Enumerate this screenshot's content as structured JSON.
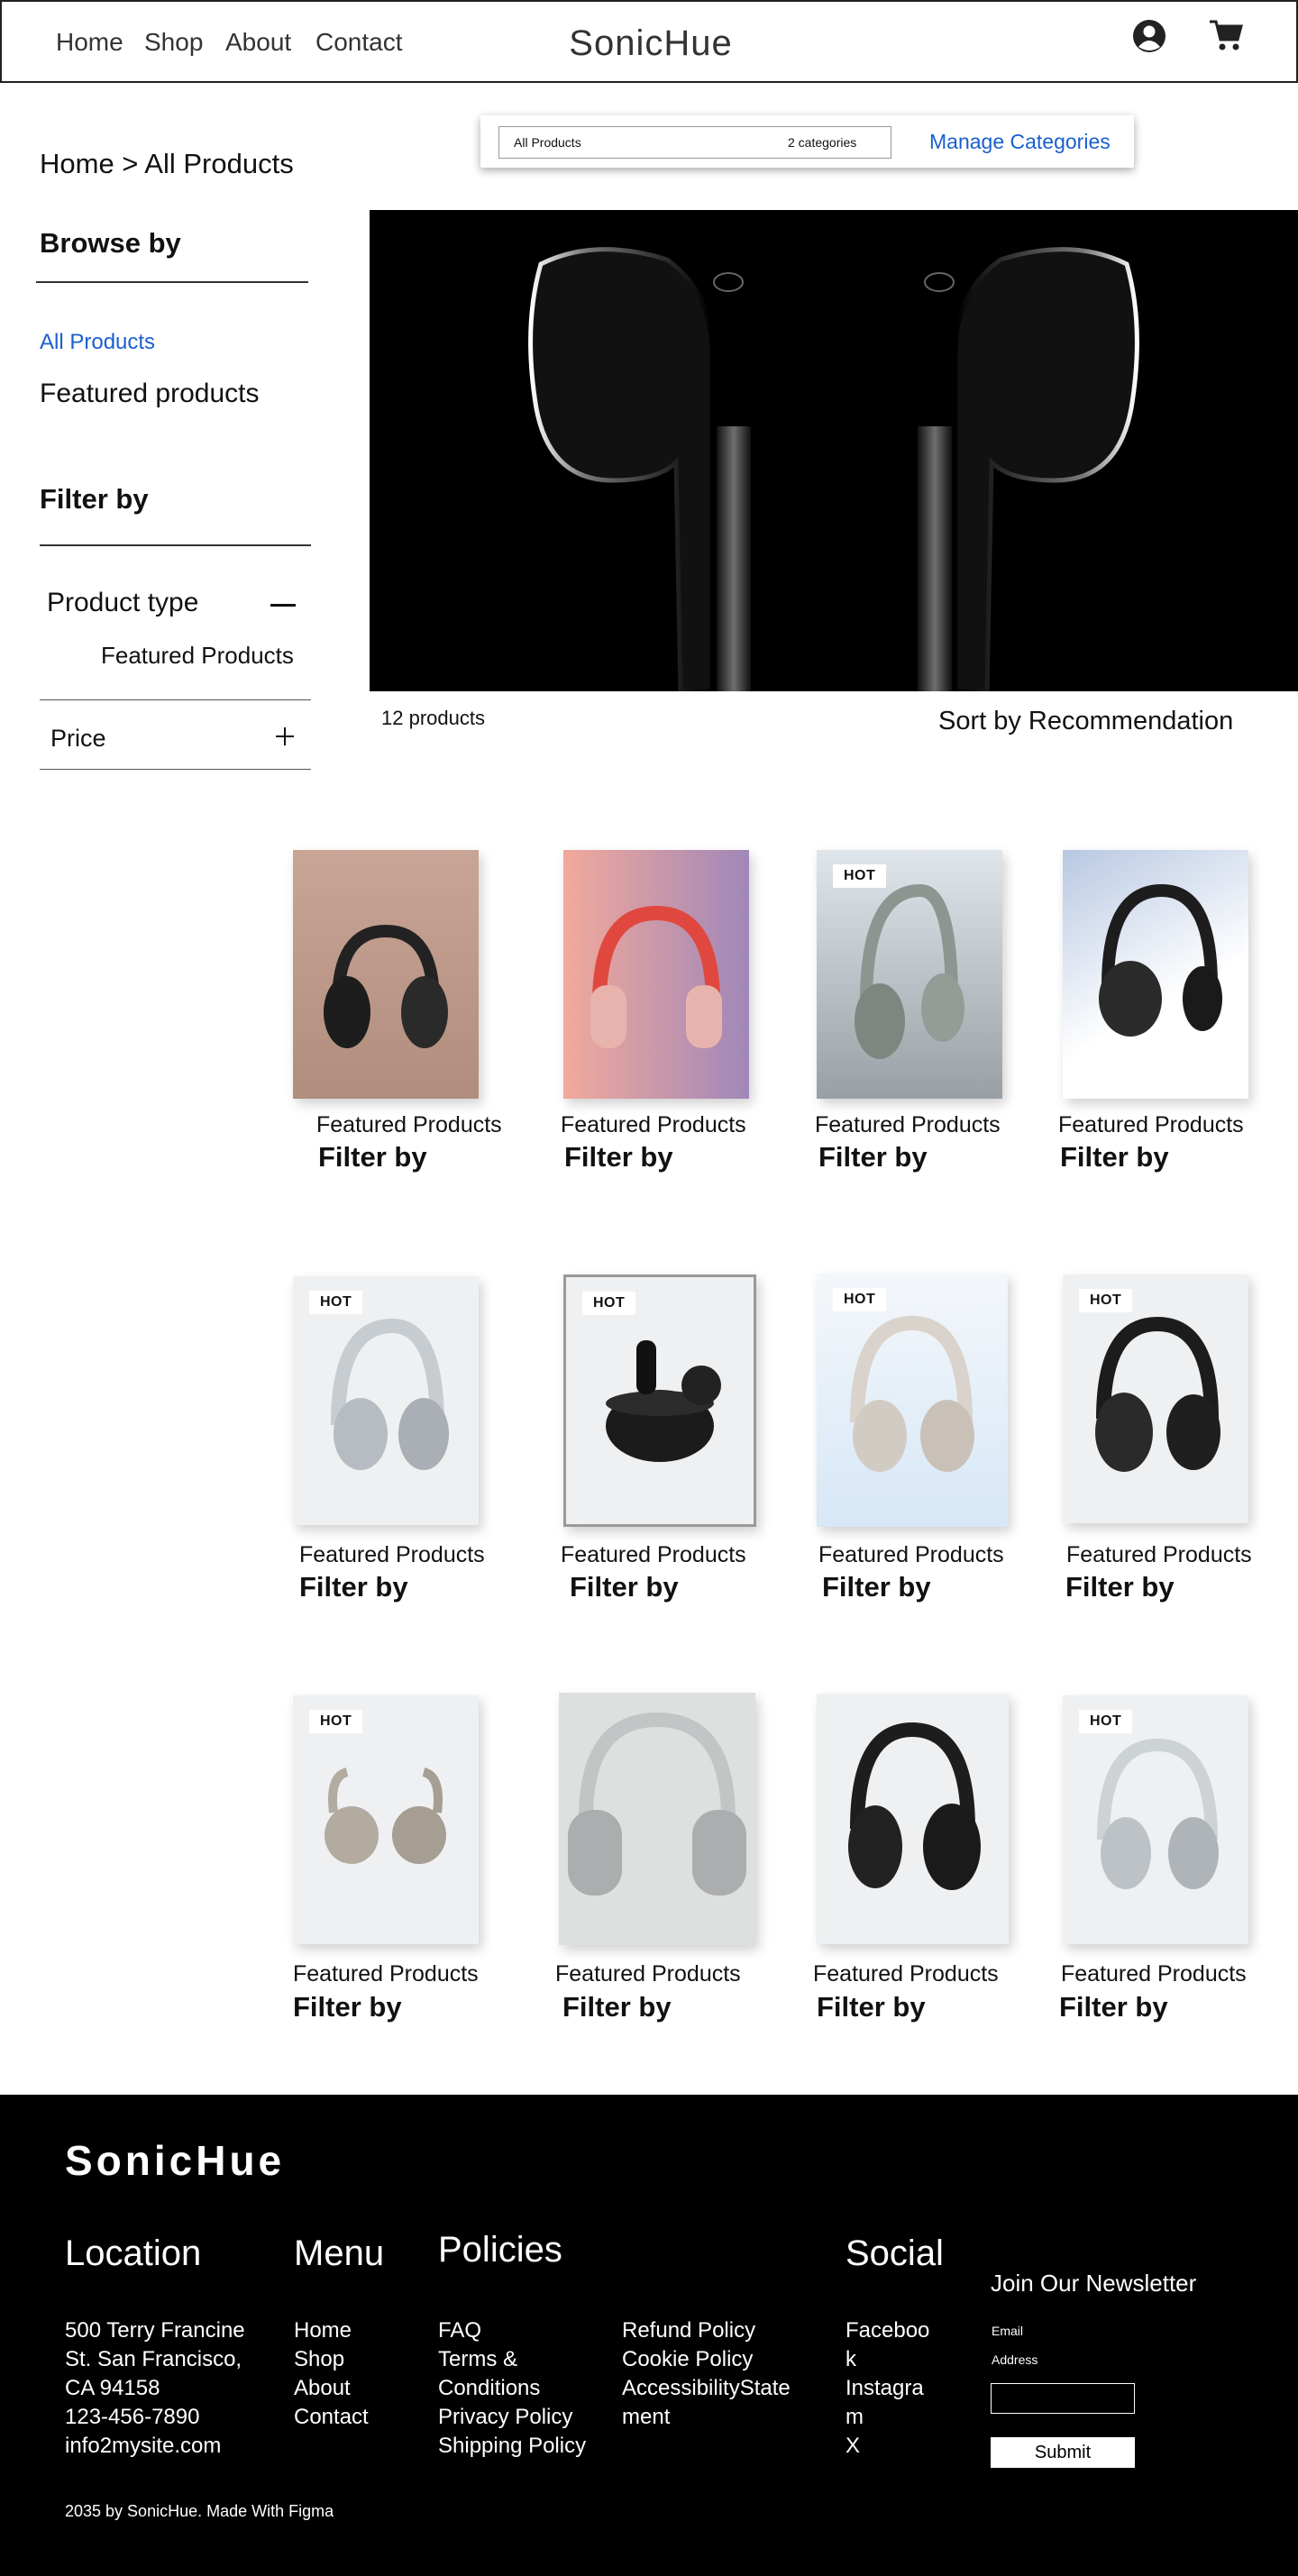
{
  "header": {
    "nav": [
      "Home",
      "Shop",
      "About",
      "Contact"
    ],
    "brand": "SonicHue"
  },
  "categories_box": {
    "select_value": "All Products",
    "count": "2 categories",
    "manage_label": "Manage Categories"
  },
  "breadcrumb": "Home > All Products",
  "sidebar": {
    "browse_title": "Browse by",
    "browse_items": [
      "All Products",
      "Featured products"
    ],
    "filter_title": "Filter by",
    "product_type_label": "Product type",
    "product_type_option": "Featured Products",
    "price_label": "Price"
  },
  "listing": {
    "count": "12 products",
    "sort_label": "Sort by Recommendation"
  },
  "products": [
    {
      "caption": "Featured Products",
      "title": "Filter by",
      "badge": ""
    },
    {
      "caption": "Featured Products",
      "title": "Filter by",
      "badge": ""
    },
    {
      "caption": "Featured Products",
      "title": "Filter by",
      "badge": "HOT"
    },
    {
      "caption": "Featured Products",
      "title": "Filter by",
      "badge": ""
    },
    {
      "caption": "Featured Products",
      "title": "Filter by",
      "badge": "HOT"
    },
    {
      "caption": "Featured Products",
      "title": "Filter by",
      "badge": "HOT"
    },
    {
      "caption": "Featured Products",
      "title": "Filter by",
      "badge": "HOT"
    },
    {
      "caption": "Featured Products",
      "title": "Filter by",
      "badge": "HOT"
    },
    {
      "caption": "Featured Products",
      "title": "Filter by",
      "badge": "HOT"
    },
    {
      "caption": "Featured Products",
      "title": "Filter by",
      "badge": ""
    },
    {
      "caption": "Featured Products",
      "title": "Filter by",
      "badge": ""
    },
    {
      "caption": "Featured Products",
      "title": "Filter by",
      "badge": "HOT"
    }
  ],
  "footer": {
    "brand": "SonicHue",
    "location_title": "Location",
    "location_lines": [
      "500 Terry Francine",
      "St. San Francisco,",
      "CA 94158",
      "123-456-7890",
      "info2mysite.com"
    ],
    "menu_title": "Menu",
    "menu_items": [
      "Home",
      "Shop",
      "About",
      "Contact"
    ],
    "policies_title": "Policies",
    "policies_col1": [
      "FAQ",
      "Terms &",
      "Conditions",
      "Privacy Policy",
      "Shipping Policy"
    ],
    "policies_col2": [
      "Refund Policy",
      "Cookie Policy",
      "AccessibilityState",
      "ment"
    ],
    "social_title": "Social",
    "social_items": [
      "Faceboo",
      "k",
      "Instagra",
      "m",
      "X"
    ],
    "newsletter_title": "Join Our Newsletter",
    "email_label_1": "Email",
    "email_label_2": "Address",
    "submit_label": "Submit",
    "copyright": "2035 by SonicHue. Made With Figma"
  },
  "colors": {
    "accent_link": "#1a5fd0",
    "footer_bg": "#000000"
  },
  "icons": [
    "user-icon",
    "cart-icon",
    "minus-icon",
    "plus-icon"
  ]
}
